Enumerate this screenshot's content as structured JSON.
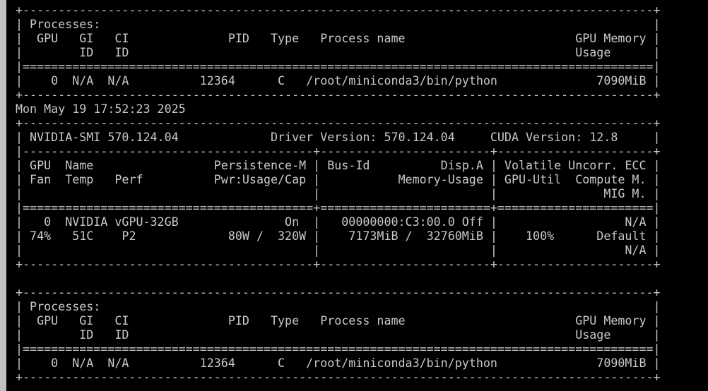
{
  "terminal": {
    "bg_color": "#000000",
    "fg_color": "#c8c8c8",
    "scrollbar_color": "#c0c0c0",
    "lines": [
      "+-----------------------------------------------------------------------------------------+",
      "| Processes:                                                                              |",
      "|  GPU   GI   CI              PID   Type   Process name                        GPU Memory |",
      "|        ID   ID                                                               Usage      |",
      "|=========================================================================================|",
      "|    0  N/A  N/A          12364      C   /root/miniconda3/bin/python              7090MiB |",
      "+-----------------------------------------------------------------------------------------+",
      "Mon May 19 17:52:23 2025",
      "+-----------------------------------------------------------------------------------------+",
      "| NVIDIA-SMI 570.124.04             Driver Version: 570.124.04     CUDA Version: 12.8     |",
      "|-----------------------------------------+------------------------+----------------------+",
      "| GPU  Name                 Persistence-M | Bus-Id          Disp.A | Volatile Uncorr. ECC |",
      "| Fan  Temp   Perf          Pwr:Usage/Cap |           Memory-Usage | GPU-Util  Compute M. |",
      "|                                         |                        |               MIG M. |",
      "|=========================================+========================+======================|",
      "|   0  NVIDIA vGPU-32GB               On  |   00000000:C3:00.0 Off |                  N/A |",
      "| 74%   51C    P2             80W /  320W |    7173MiB /  32760MiB |    100%      Default |",
      "|                                         |                        |                  N/A |",
      "+-----------------------------------------+------------------------+----------------------+",
      "",
      "+-----------------------------------------------------------------------------------------+",
      "| Processes:                                                                              |",
      "|  GPU   GI   CI              PID   Type   Process name                        GPU Memory |",
      "|        ID   ID                                                               Usage      |",
      "|=========================================================================================|",
      "|    0  N/A  N/A          12364      C   /root/miniconda3/bin/python              7090MiB |",
      "+-----------------------------------------------------------------------------------------+"
    ]
  }
}
